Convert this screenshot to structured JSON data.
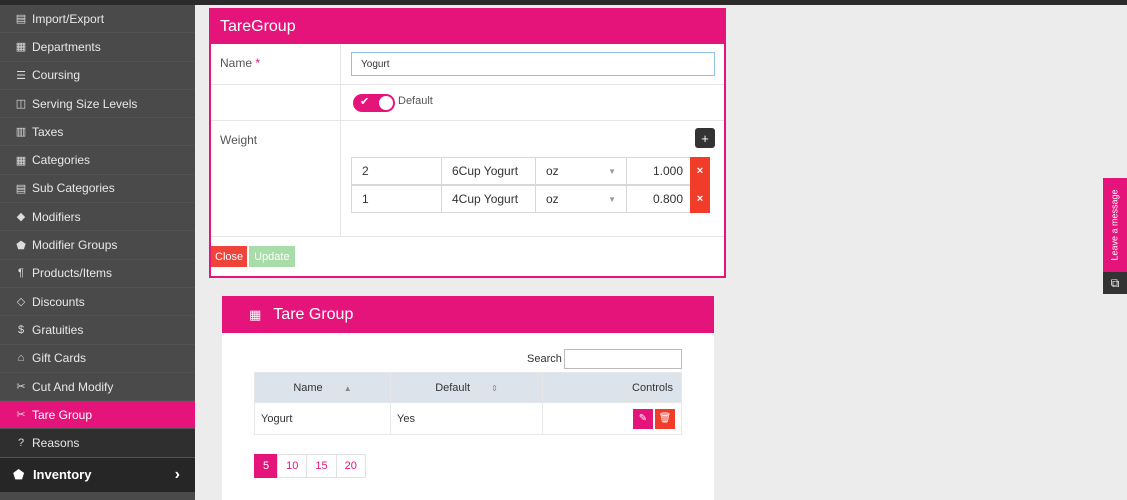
{
  "sidebar": {
    "items": [
      {
        "label": "Import/Export",
        "icon": "import-export-icon",
        "glyph": "▤"
      },
      {
        "label": "Departments",
        "icon": "departments-icon",
        "glyph": "▦"
      },
      {
        "label": "Coursing",
        "icon": "coursing-icon",
        "glyph": "☰"
      },
      {
        "label": "Serving Size Levels",
        "icon": "serving-size-icon",
        "glyph": "◫"
      },
      {
        "label": "Taxes",
        "icon": "taxes-icon",
        "glyph": "▥"
      },
      {
        "label": "Categories",
        "icon": "categories-icon",
        "glyph": "▦"
      },
      {
        "label": "Sub Categories",
        "icon": "sub-categories-icon",
        "glyph": "▤"
      },
      {
        "label": "Modifiers",
        "icon": "modifiers-icon",
        "glyph": "◆"
      },
      {
        "label": "Modifier Groups",
        "icon": "modifier-groups-icon",
        "glyph": "⬟"
      },
      {
        "label": "Products/Items",
        "icon": "products-icon",
        "glyph": "¶"
      },
      {
        "label": "Discounts",
        "icon": "discounts-icon",
        "glyph": "◇"
      },
      {
        "label": "Gratuities",
        "icon": "gratuities-icon",
        "glyph": "$"
      },
      {
        "label": "Gift Cards",
        "icon": "gift-cards-icon",
        "glyph": "⌂"
      },
      {
        "label": "Cut And Modify",
        "icon": "cut-modify-icon",
        "glyph": "✂"
      },
      {
        "label": "Tare Group",
        "icon": "tare-group-icon",
        "glyph": "✂"
      },
      {
        "label": "Reasons",
        "icon": "reasons-icon",
        "glyph": "?"
      }
    ],
    "active_index": 14,
    "inventory_label": "Inventory",
    "inventory_glyph": "⬟",
    "inventory_chevron": "›"
  },
  "form": {
    "title": "TareGroup",
    "name_label": "Name",
    "required_mark": "*",
    "name_value": "Yogurt",
    "default_label": "Default",
    "default_on": true,
    "weight_label": "Weight",
    "add_glyph": "+",
    "weights": [
      {
        "qty": "2",
        "item": "6Cup Yogurt",
        "unit": "oz",
        "amount": "1.000"
      },
      {
        "qty": "1",
        "item": "4Cup Yogurt",
        "unit": "oz",
        "amount": "0.800"
      }
    ],
    "delete_glyph": "×",
    "close_label": "Close",
    "update_label": "Update"
  },
  "grid": {
    "title": "Tare Group",
    "search_label": "Search",
    "columns": [
      "Name",
      "Default",
      "Controls"
    ],
    "rows": [
      {
        "name": "Yogurt",
        "default": "Yes"
      }
    ],
    "page_sizes": [
      "5",
      "10",
      "15",
      "20"
    ],
    "active_page_size": "5"
  },
  "chat": {
    "label": "Leave a message"
  },
  "colors": {
    "accent": "#e5147b",
    "danger": "#f03c28",
    "sidebar_bg": "#4a4a4a"
  }
}
